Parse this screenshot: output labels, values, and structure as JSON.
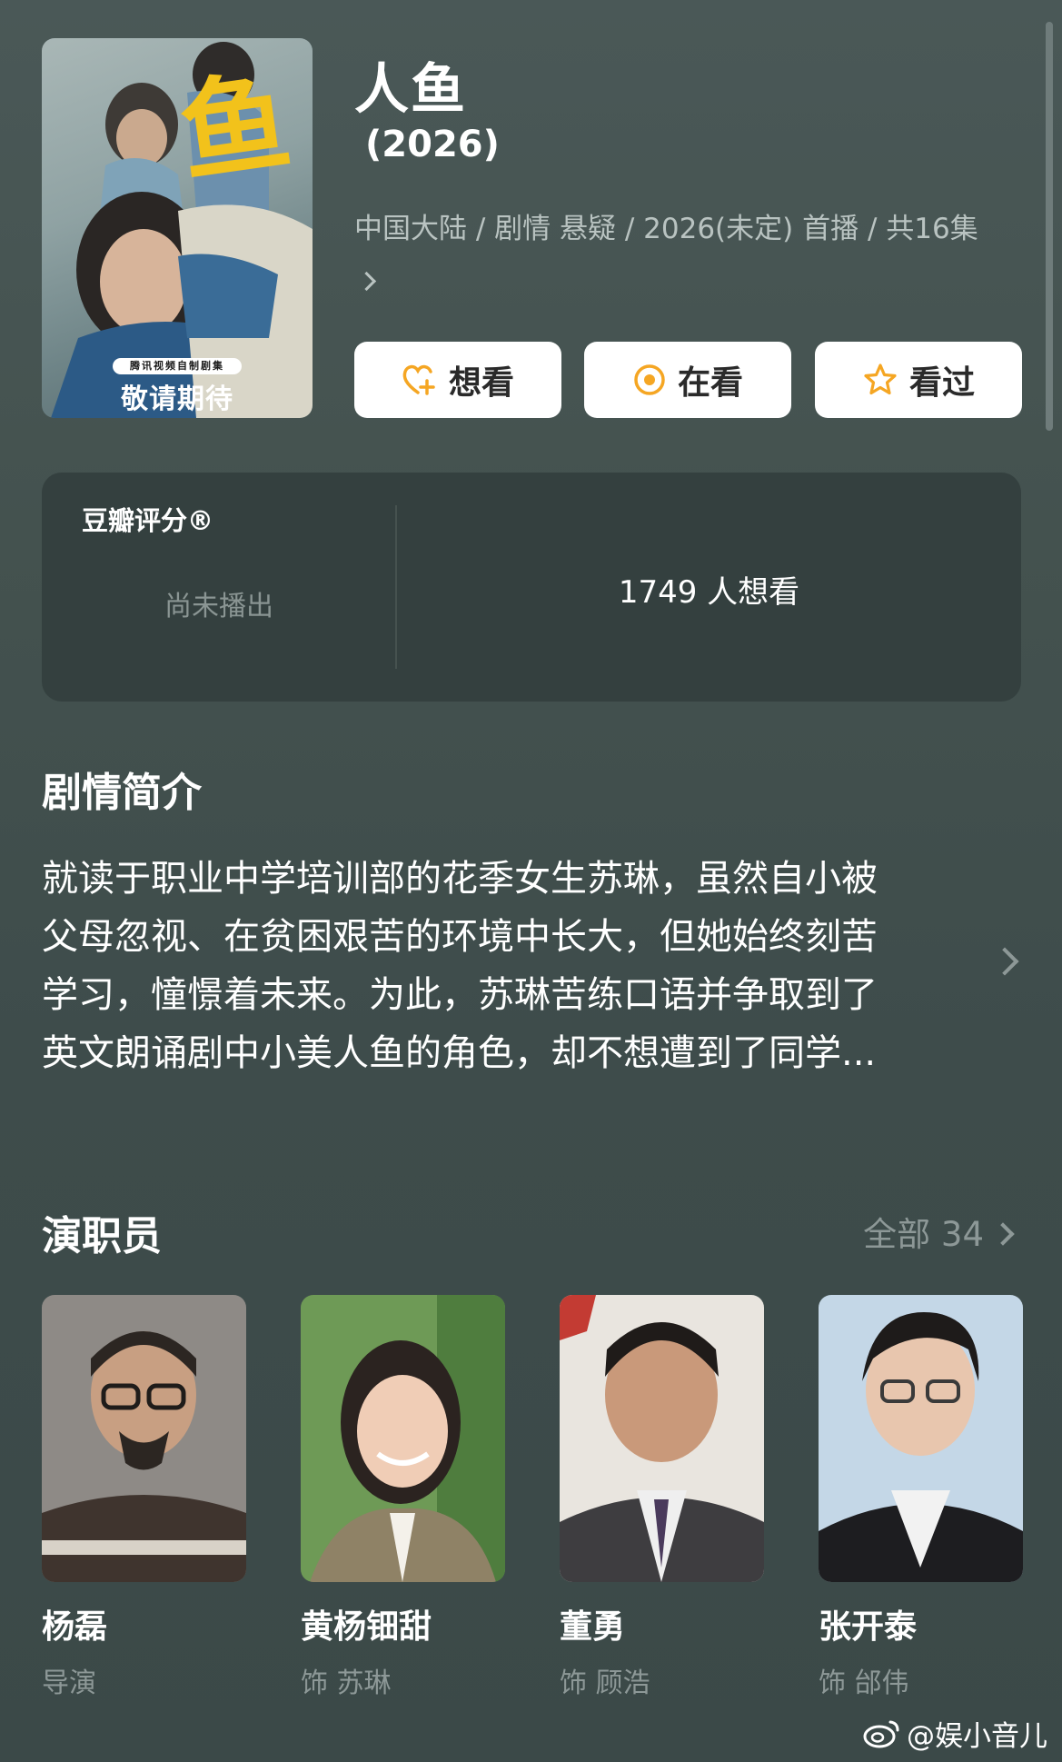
{
  "poster": {
    "logo_glyph": "鱼",
    "badge": "腾讯视频自制剧集",
    "tagline": "敬请期待"
  },
  "header": {
    "title": "人鱼",
    "year": "(2026)",
    "meta": "中国大陆 / 剧情 悬疑 / 2026(未定) 首播 / 共16集"
  },
  "actions": {
    "want_label": "想看",
    "watching_label": "在看",
    "watched_label": "看过"
  },
  "rating": {
    "label": "豆瓣评分®",
    "status": "尚未播出",
    "want_count": "1749 人想看"
  },
  "synopsis": {
    "title": "剧情简介",
    "lines": [
      "就读于职业中学培训部的花季女生苏琳，虽然自小被",
      "父母忽视、在贫困艰苦的环境中长大，但她始终刻苦",
      "学习，憧憬着未来。为此，苏琳苦练口语并争取到了",
      "英文朗诵剧中小美人鱼的角色，却不想遭到了同学..."
    ]
  },
  "cast": {
    "title": "演职员",
    "all_label": "全部 34",
    "members": [
      {
        "name": "杨磊",
        "role": "导演"
      },
      {
        "name": "黄杨钿甜",
        "role": "饰 苏琳"
      },
      {
        "name": "董勇",
        "role": "饰 顾浩"
      },
      {
        "name": "张开泰",
        "role": "饰 邰伟"
      }
    ]
  },
  "watermark": "@娱小音儿",
  "colors": {
    "background": "#3d4b4a",
    "card": "#34403f",
    "accent": "#f5a623",
    "muted_text": "#8d9897"
  }
}
